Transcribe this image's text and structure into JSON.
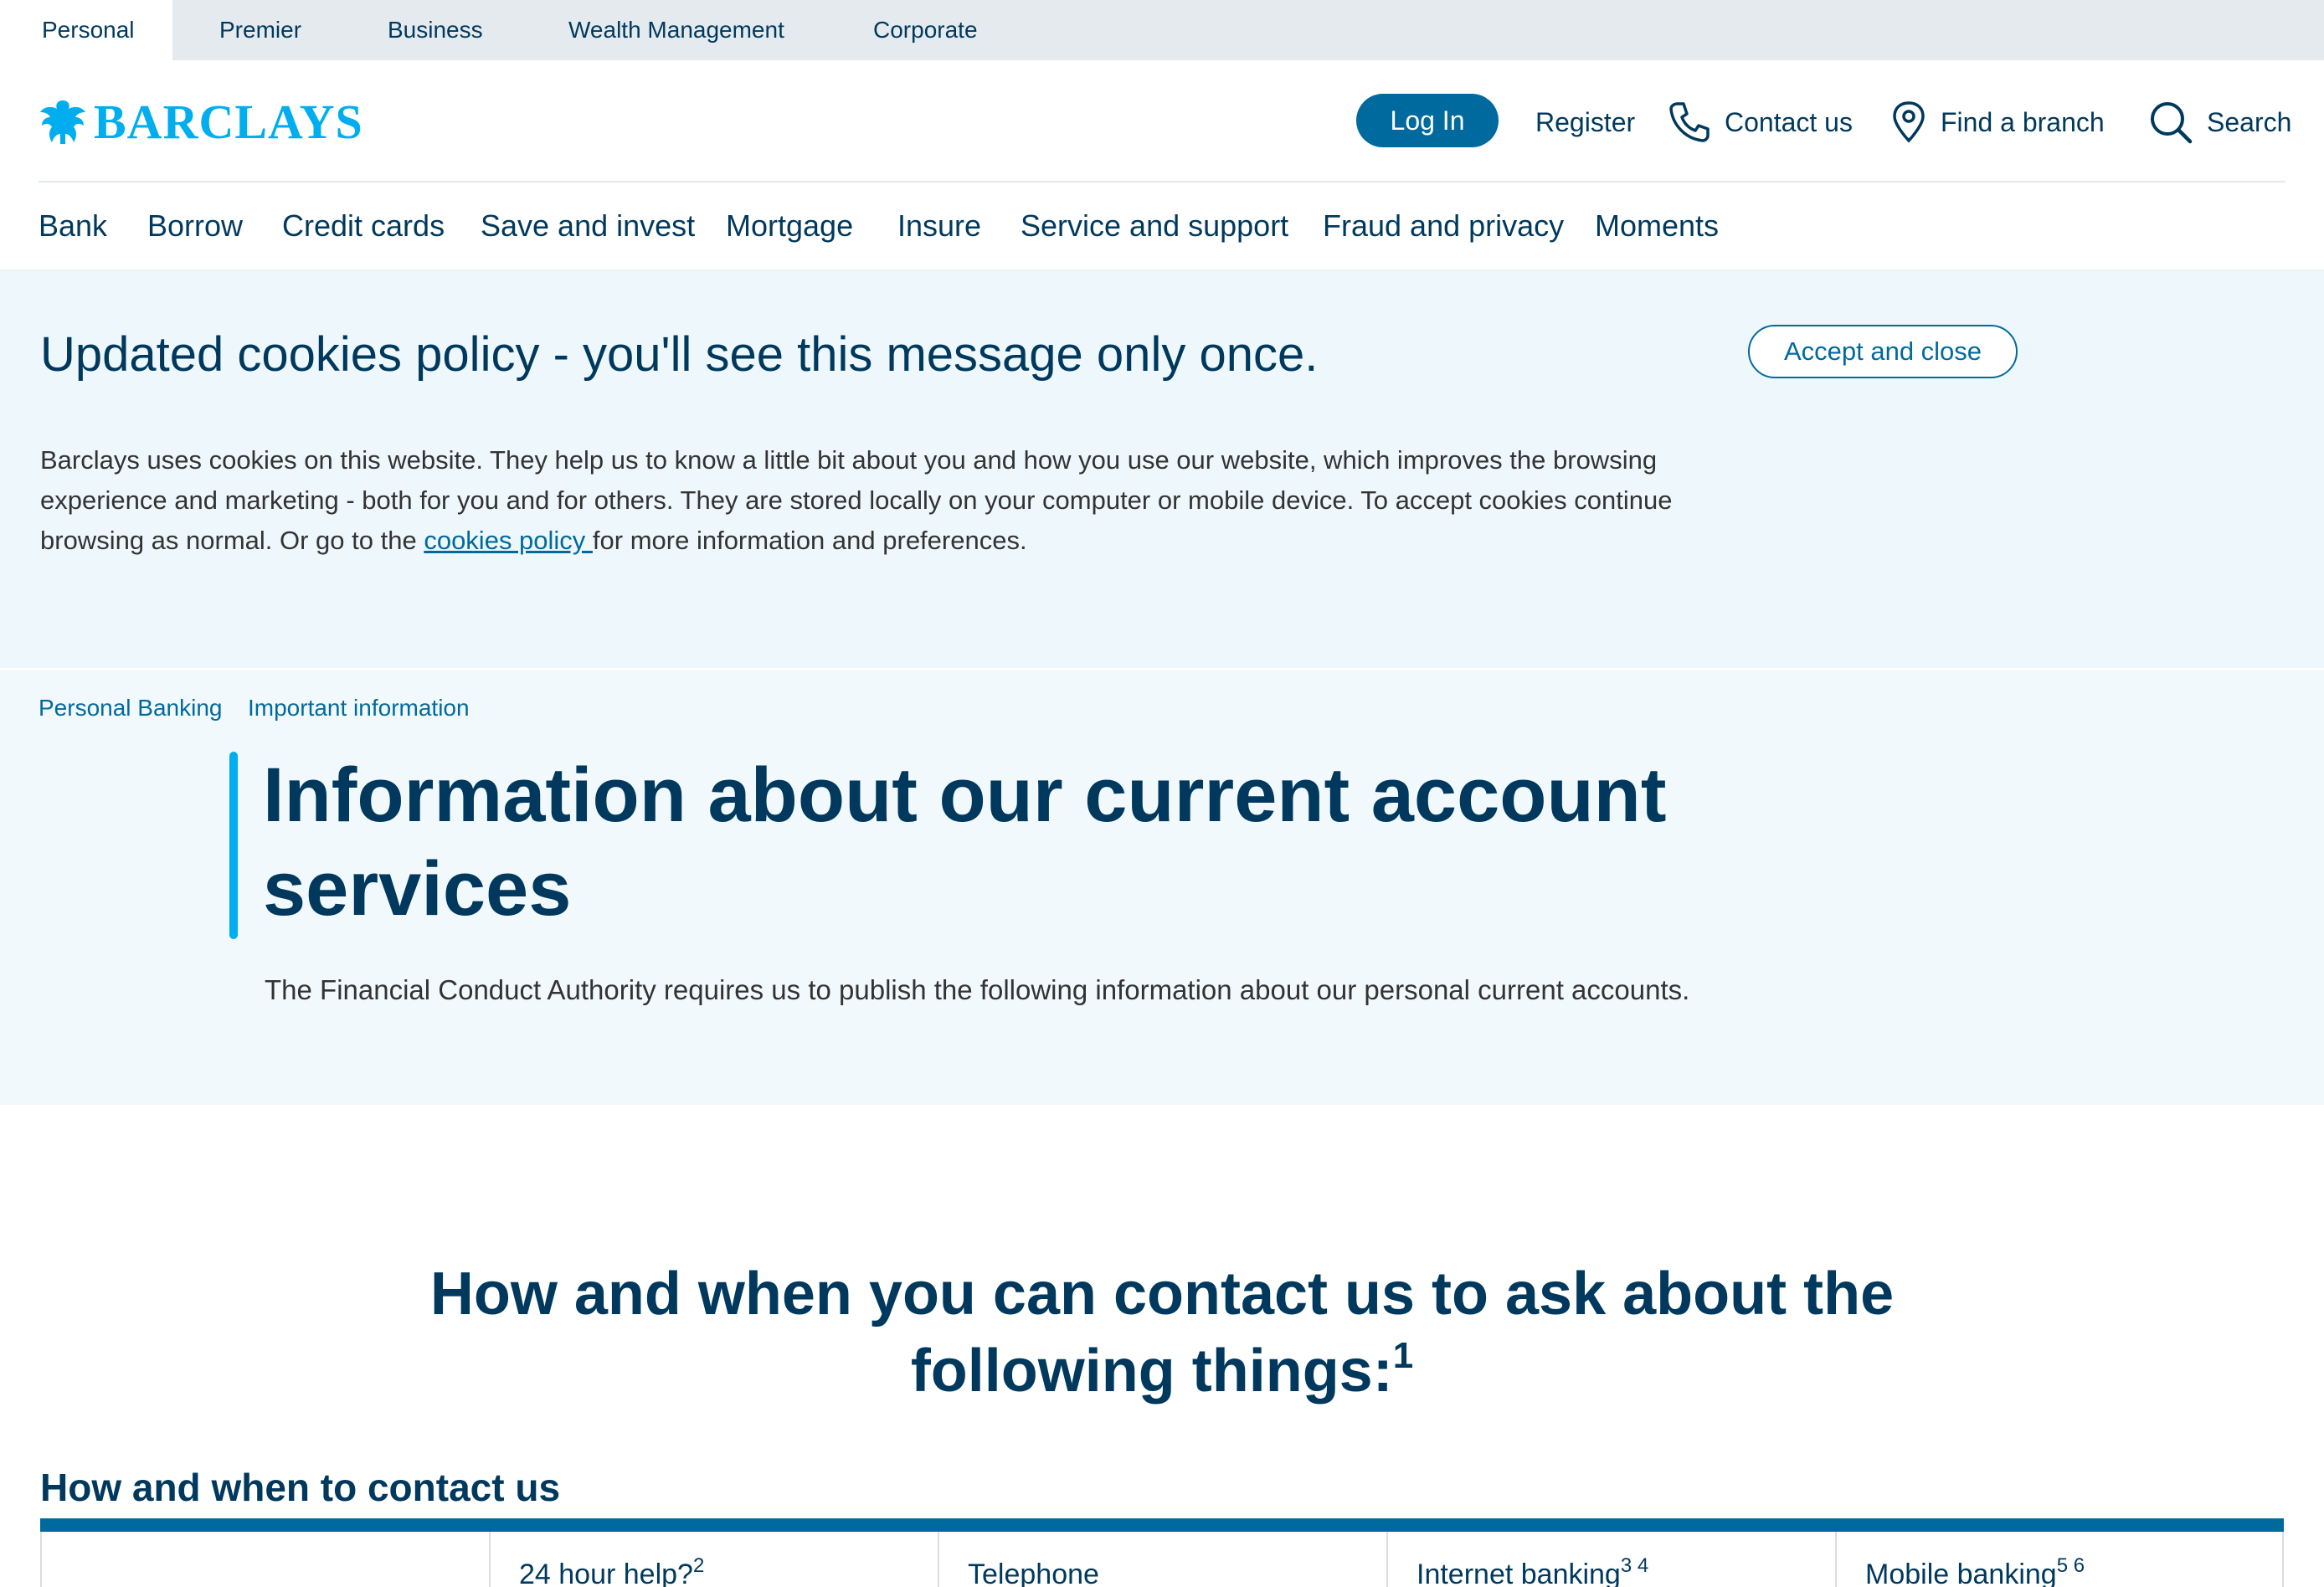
{
  "segments": [
    "Personal",
    "Premier",
    "Business",
    "Wealth Management",
    "Corporate"
  ],
  "brand": {
    "name": "BARCLAYS",
    "icon": "eagle-icon",
    "color": "#00aeef"
  },
  "header": {
    "login_label": "Log In",
    "register_label": "Register",
    "contact_label": "Contact us",
    "branch_label": "Find a branch",
    "search_label": "Search"
  },
  "nav": [
    "Bank",
    "Borrow",
    "Credit cards",
    "Save and invest",
    "Mortgage",
    "Insure",
    "Service and support",
    "Fraud and privacy",
    "Moments"
  ],
  "cookie": {
    "title": "Updated cookies policy - you'll see this message only once.",
    "accept_label": "Accept and close",
    "text_before": "Barclays uses cookies on this website. They help us to know a little bit about you and how you use our website, which improves the browsing experience and marketing - both for you and for others. They are stored locally on your computer or mobile device. To accept cookies continue browsing as normal. Or go to the ",
    "link_label": "cookies policy ",
    "text_after": "for more information and preferences."
  },
  "breadcrumb": [
    "Personal Banking",
    "Important information"
  ],
  "hero": {
    "title": "Information about our current account services",
    "subtitle": "The Financial Conduct Authority requires us to publish the following information about our personal current accounts."
  },
  "section": {
    "heading": "How and when you can contact us to ask about the following things:",
    "heading_note": "1",
    "subheading": "How and when to contact us"
  },
  "table_headers": [
    {
      "label": "",
      "sup": ""
    },
    {
      "label": "24 hour help?",
      "sup": "2"
    },
    {
      "label": "Telephone",
      "sup": ""
    },
    {
      "label": "Internet banking",
      "sup": "3 4"
    },
    {
      "label": "Mobile banking",
      "sup": "5 6"
    }
  ],
  "colors": {
    "navy": "#00395d",
    "accent": "#006a9f",
    "cyan": "#00aeef",
    "banner_bg": "#eef7fb"
  }
}
